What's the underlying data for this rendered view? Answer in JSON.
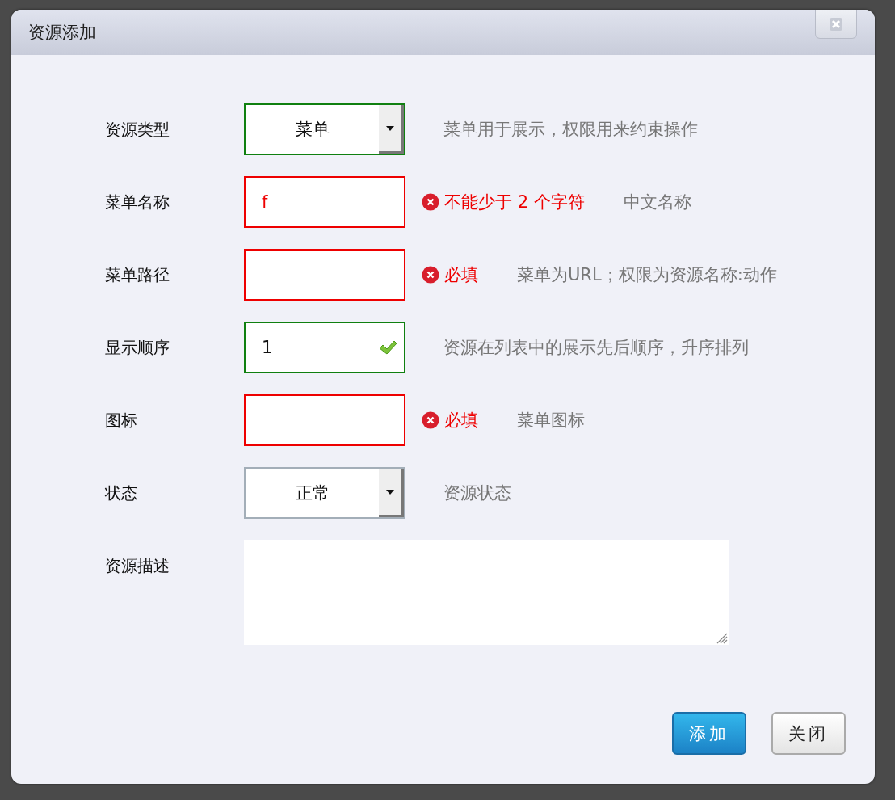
{
  "dialog": {
    "title": "资源添加"
  },
  "fields": [
    {
      "kind": "select",
      "label": "资源类型",
      "value": "菜单",
      "valid": true,
      "invalid": false,
      "hint": "菜单用于展示，权限用来约束操作"
    },
    {
      "kind": "input",
      "label": "菜单名称",
      "value": "f",
      "valid": false,
      "invalid": true,
      "error": "不能少于 2 个字符",
      "hint": "中文名称"
    },
    {
      "kind": "input",
      "label": "菜单路径",
      "valid": false,
      "invalid": true,
      "error": "必填",
      "hint": "菜单为URL；权限为资源名称:动作"
    },
    {
      "kind": "input",
      "label": "显示顺序",
      "value": "1",
      "valid": true,
      "invalid": false,
      "hint": "资源在列表中的展示先后顺序，升序排列"
    },
    {
      "kind": "input",
      "label": "图标",
      "valid": false,
      "invalid": true,
      "error": "必填",
      "hint": "菜单图标"
    },
    {
      "kind": "select",
      "label": "状态",
      "value": "正常",
      "valid": false,
      "invalid": false,
      "hint": "资源状态"
    },
    {
      "kind": "textarea",
      "label": "资源描述"
    }
  ],
  "buttons": [
    {
      "kind": "primary",
      "label": "添加"
    },
    {
      "kind": "default",
      "label": "关闭"
    }
  ]
}
